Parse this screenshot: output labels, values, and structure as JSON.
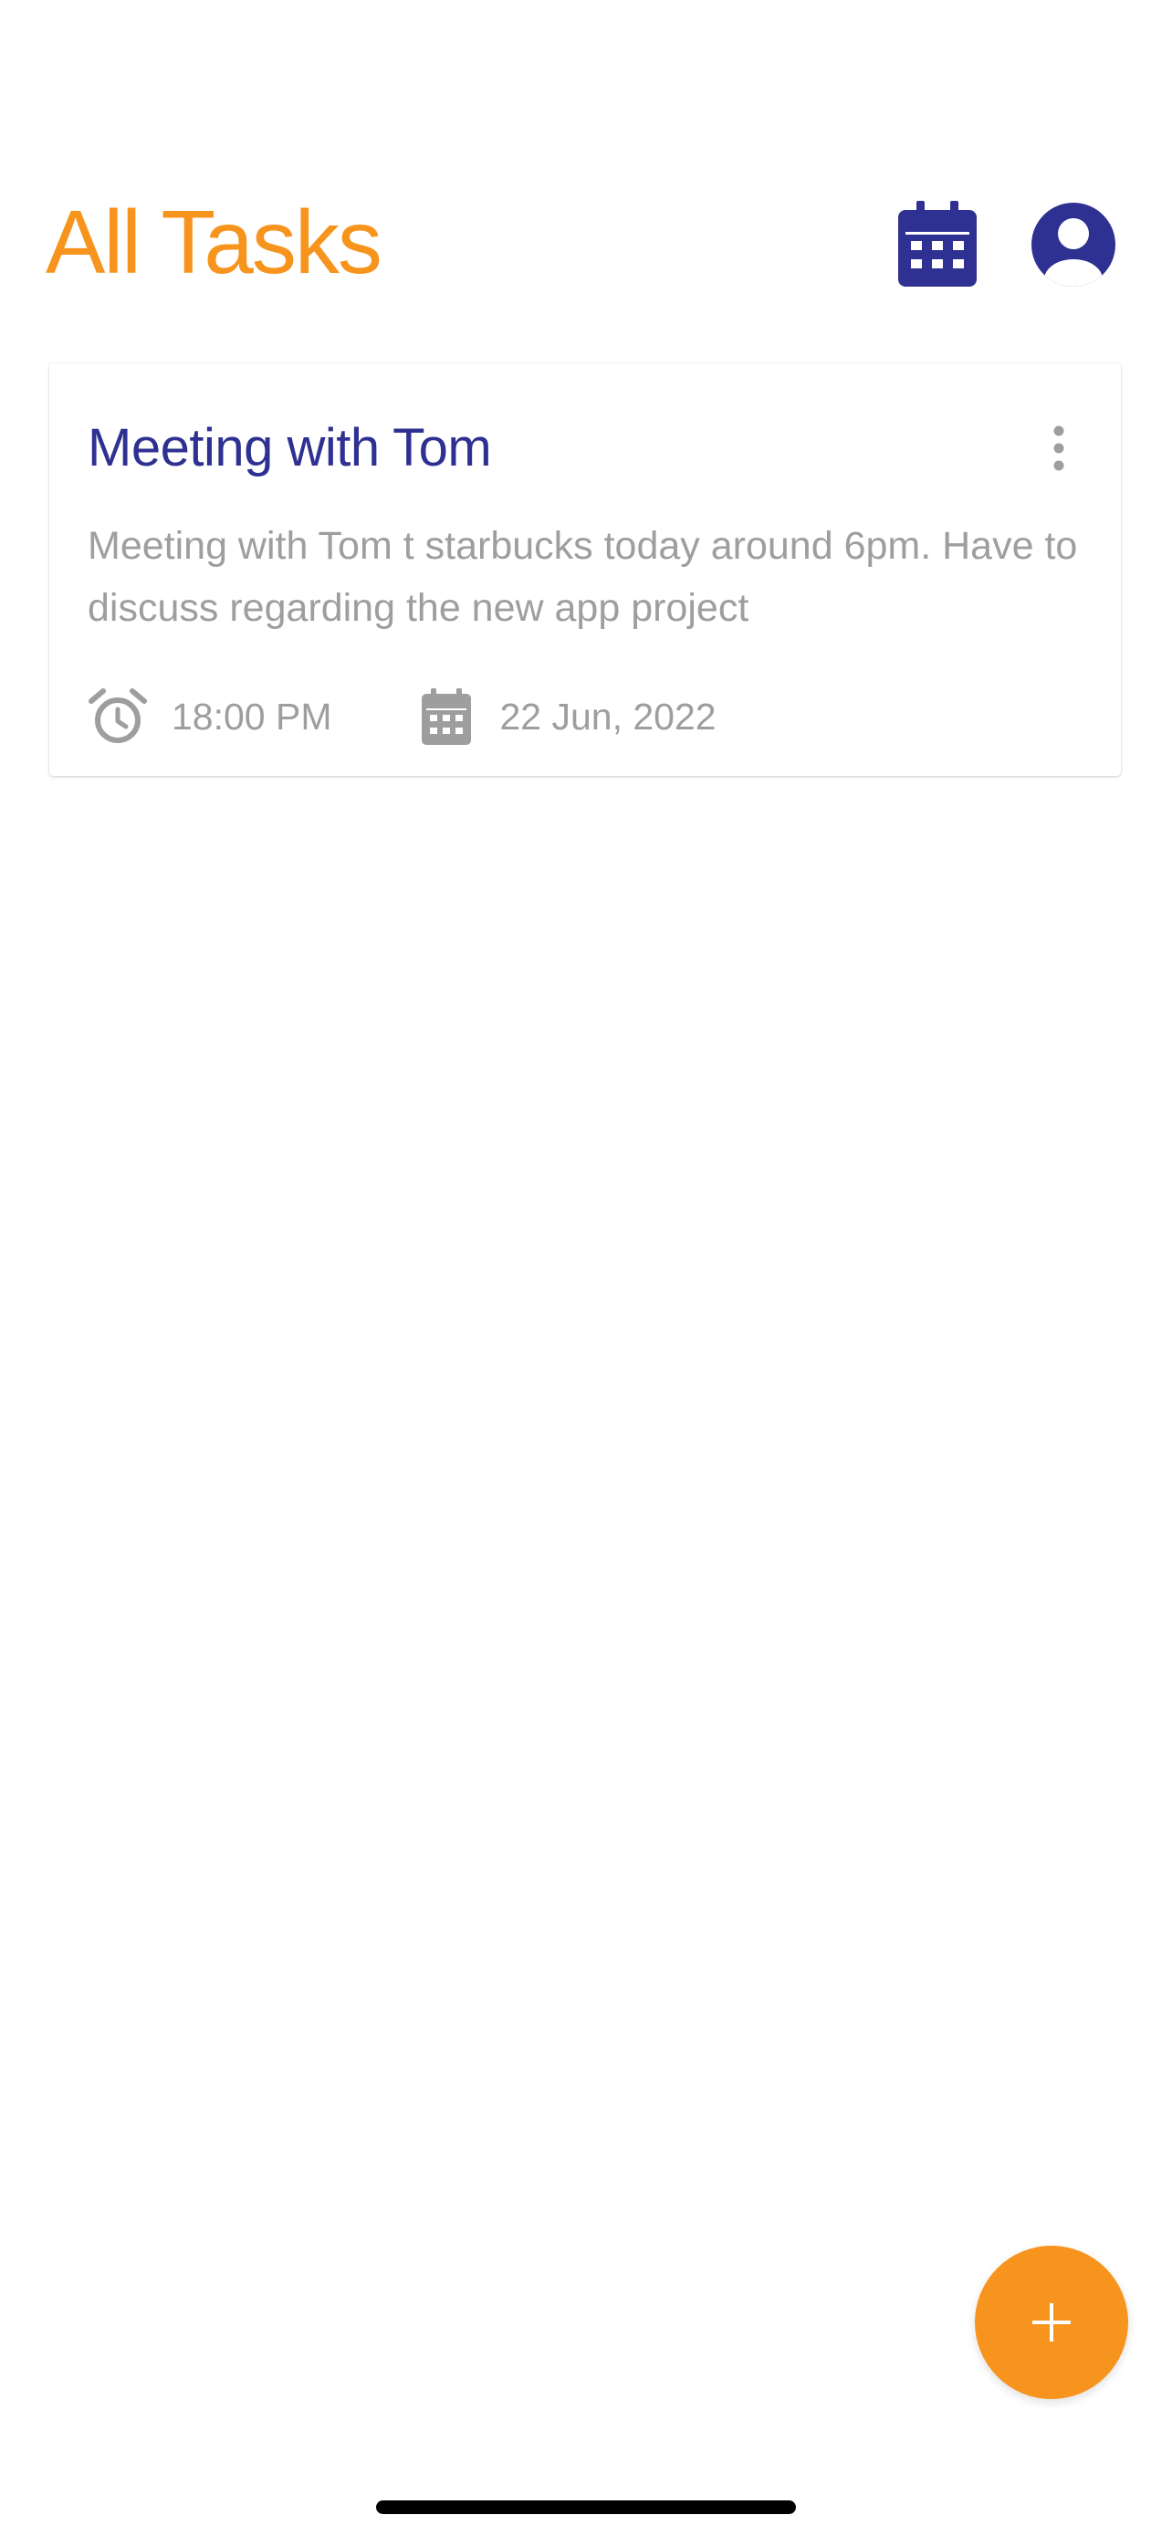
{
  "header": {
    "title": "All Tasks",
    "calendar_icon": "calendar-icon",
    "profile_icon": "account-circle-icon"
  },
  "tasks": [
    {
      "title": "Meeting with Tom",
      "description": "Meeting with Tom t starbucks today around 6pm. Have to discuss regarding the new app project",
      "time": "18:00 PM",
      "date": "22 Jun, 2022",
      "time_icon": "alarm-icon",
      "date_icon": "calendar-icon",
      "menu_icon": "more-vert-icon"
    }
  ],
  "fab": {
    "icon": "plus-icon"
  },
  "colors": {
    "accent": "#F7941D",
    "primary": "#2E3192",
    "muted_text": "#9E9E9E",
    "background": "#FFFFFF"
  }
}
